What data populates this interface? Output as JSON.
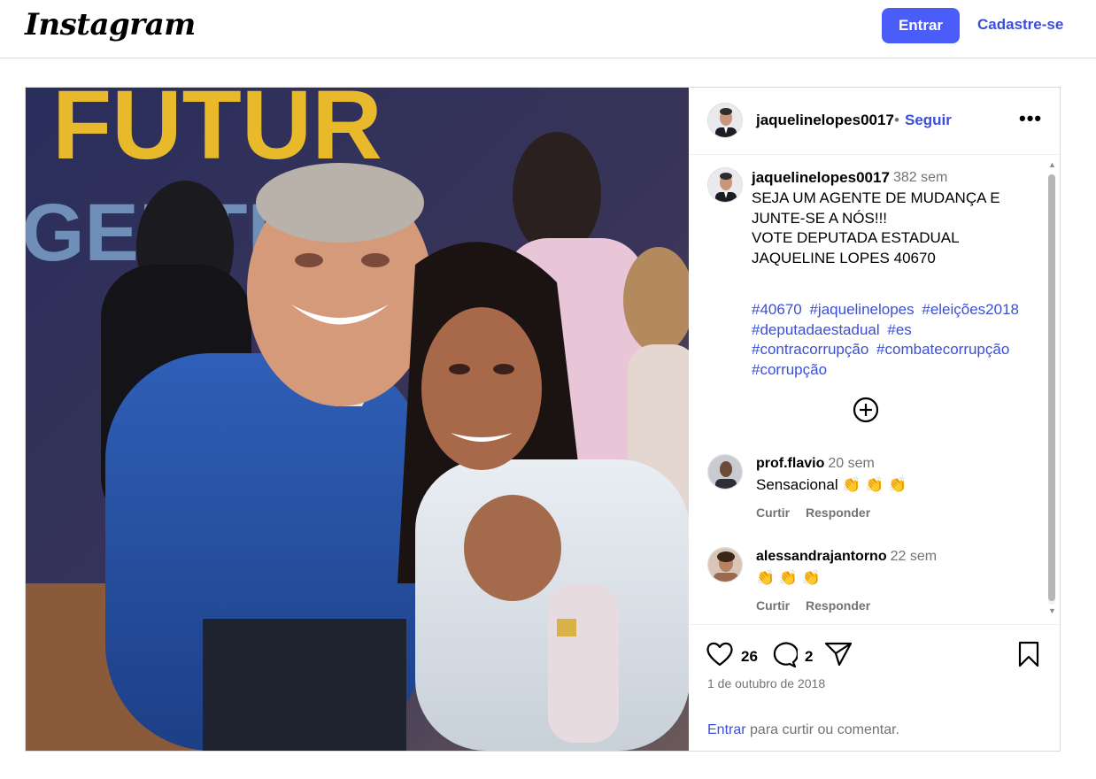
{
  "header": {
    "logo_text": "Instagram",
    "login_label": "Entrar",
    "signup_label": "Cadastre-se"
  },
  "post": {
    "username": "jaquelinelopes0017",
    "separator": "•",
    "follow_label": "Seguir",
    "more_label": "•••",
    "caption": {
      "username": "jaquelinelopes0017",
      "time": "382 sem",
      "text": "SEJA UM AGENTE DE MUDANÇA E JUNTE-SE A NÓS!!!\nVOTE DEPUTADA ESTADUAL JAQUELINE LOPES 40670",
      "hashtags": [
        "#40670",
        "#jaquelinelopes",
        "#eleições2018",
        "#deputadaestadual",
        "#es",
        "#contracorrupção",
        "#combatecorrupção",
        "#corrupção"
      ]
    },
    "comments": [
      {
        "username": "prof.flavio",
        "time": "20 sem",
        "text": "Sensacional 👏 👏 👏",
        "like_label": "Curtir",
        "reply_label": "Responder"
      },
      {
        "username": "alessandrajantorno",
        "time": "22 sem",
        "text": "👏 👏 👏",
        "like_label": "Curtir",
        "reply_label": "Responder"
      }
    ],
    "likes_count": "26",
    "comments_count": "2",
    "date": "1 de outubro de 2018",
    "login_prompt_link": "Entrar",
    "login_prompt_rest": " para curtir ou comentar.",
    "photo_backdrop_text": [
      "FUTUR",
      "GENTE"
    ]
  },
  "colors": {
    "accent_button": "#4a5df9",
    "link": "#3b4fd6",
    "secondary_text": "#737373"
  },
  "icons": [
    "heart-icon",
    "comment-icon",
    "share-icon",
    "bookmark-icon",
    "plus-circle-icon",
    "more-options-icon"
  ]
}
